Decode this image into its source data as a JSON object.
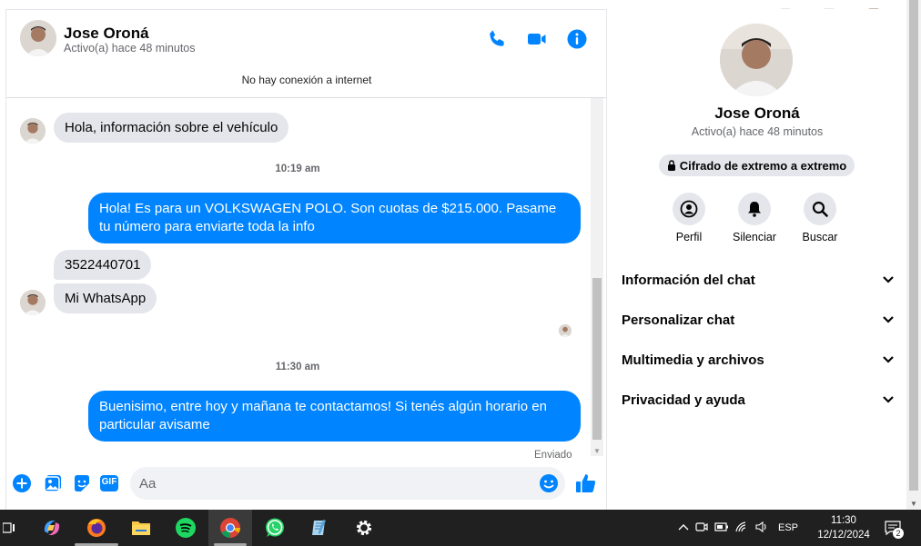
{
  "contact": {
    "name": "Jose Oroná",
    "status": "Activo(a) hace 48 minutos"
  },
  "header": {
    "connection_notice": "No hay conexión a internet",
    "actions": [
      "phone-icon",
      "video-icon",
      "info-icon"
    ]
  },
  "messages": {
    "m1": "Hola, información sobre el vehículo",
    "t1": "10:19 am",
    "m2": "Hola! Es para un VOLKSWAGEN POLO. Son cuotas de $215.000. Pasame tu número para enviarte toda la info",
    "m3": "3522440701",
    "m4": "Mi WhatsApp",
    "t2": "11:30 am",
    "m5": "Buenisimo, entre hoy y mañana te contactamos! Si tenés algún horario en particular avisame",
    "sent_label": "Enviado"
  },
  "composer": {
    "placeholder": "Aa",
    "gif_label": "GIF"
  },
  "info_panel": {
    "e2e_label": "Cifrado de extremo a extremo",
    "actions": {
      "profile": "Perfil",
      "mute": "Silenciar",
      "search": "Buscar"
    },
    "sections": {
      "s1": "Información del chat",
      "s2": "Personalizar chat",
      "s3": "Multimedia y archivos",
      "s4": "Privacidad y ayuda"
    }
  },
  "taskbar": {
    "apps": [
      "copilot-icon",
      "firefox-icon",
      "file-explorer-icon",
      "spotify-icon",
      "chrome-icon",
      "whatsapp-icon",
      "notepad-icon",
      "settings-icon"
    ],
    "language": "ESP",
    "time": "11:30",
    "date": "12/12/2024",
    "notification_count": "2"
  },
  "colors": {
    "accent": "#0084ff",
    "bubble_incoming": "#e4e6eb",
    "muted_text": "#65676b",
    "taskbar": "#202020"
  }
}
